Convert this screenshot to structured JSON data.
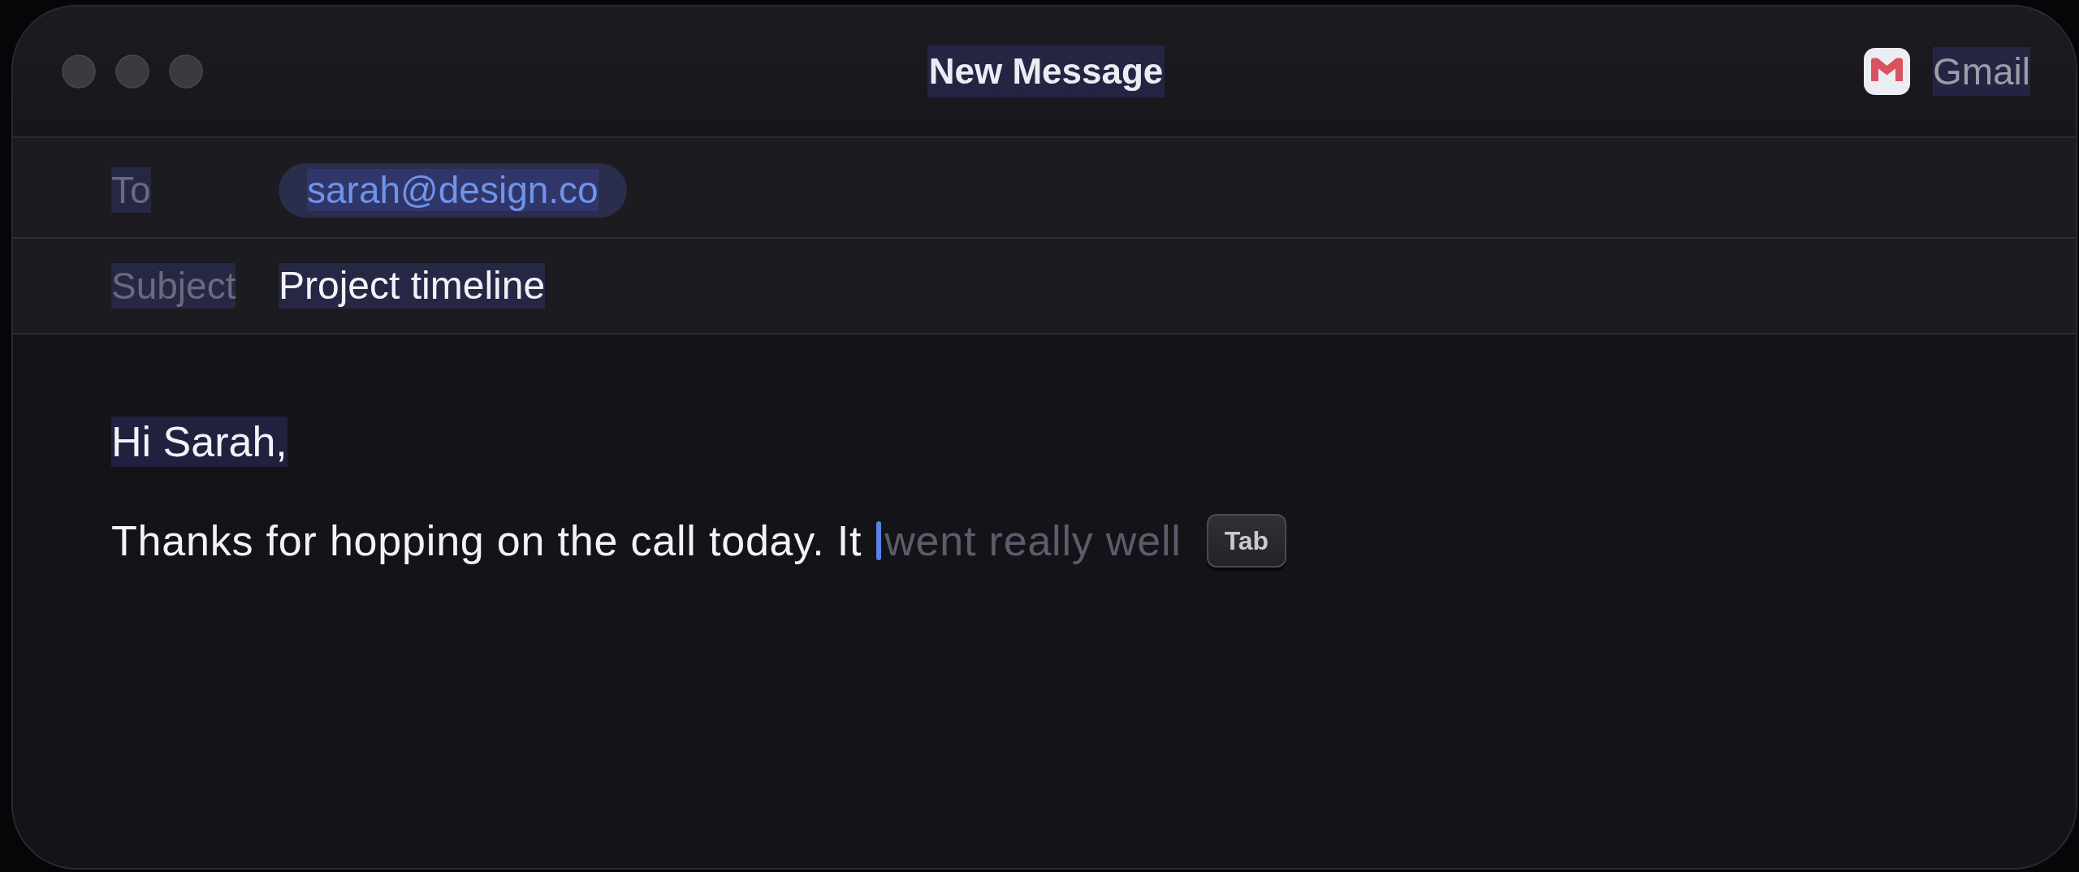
{
  "window": {
    "title": "New Message",
    "account": {
      "name": "Gmail"
    }
  },
  "fields": [
    {
      "kind": "recipients",
      "label": "To",
      "recipients": [
        "sarah@design.co"
      ]
    },
    {
      "kind": "subject",
      "label": "Subject",
      "value": "Project timeline"
    }
  ],
  "body": {
    "paragraphs": [
      {
        "kind": "text",
        "text": "Hi Sarah,"
      },
      {
        "kind": "autocomplete",
        "text": "Thanks for hopping on the call today. It",
        "suggestion": "went really well",
        "accept_key": "Tab"
      }
    ]
  }
}
